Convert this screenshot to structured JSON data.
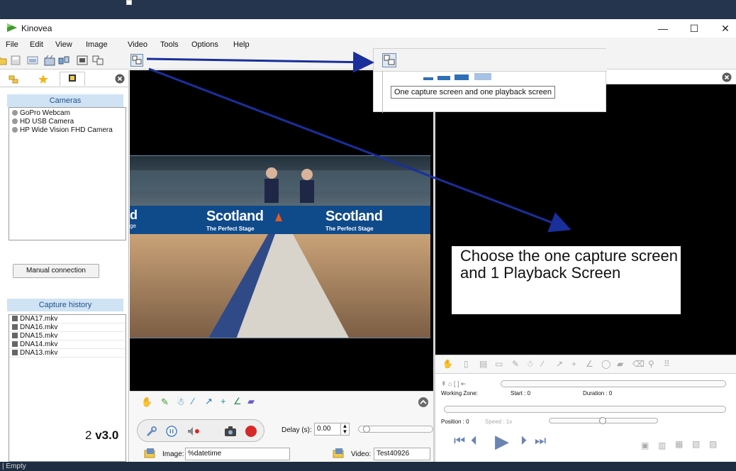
{
  "app": {
    "title": "Kinovea"
  },
  "window_controls": {
    "minimize": "—",
    "maximize": "☐",
    "close": "✕"
  },
  "menu": [
    "File",
    "Edit",
    "View",
    "Image",
    "Video",
    "Tools",
    "Options",
    "Help"
  ],
  "left_panel": {
    "cameras_title": "Cameras",
    "cameras": [
      "GoPro Webcam",
      "HD USB Camera",
      "HP Wide Vision FHD Camera"
    ],
    "manual_connection": "Manual connection",
    "history_title": "Capture history",
    "history": [
      "DNA17.mkv",
      "DNA16.mkv",
      "DNA15.mkv",
      "DNA14.mkv",
      "DNA13.mkv"
    ],
    "version_overlay": {
      "prefix": "2 ",
      "version": "v3.0"
    }
  },
  "capture": {
    "banner_left": "d",
    "banner_left_sub": "ge",
    "banner1_title": "Scotland",
    "banner1_sub": "The Perfect Stage",
    "banner2_title": "Scotland",
    "banner2_sub": "The Perfect Stage",
    "delay_label": "Delay (s):",
    "delay_value": "0.00",
    "image_label": "Image:",
    "image_value": "%datetime",
    "video_label": "Video:",
    "video_value": "Test40926"
  },
  "playback": {
    "working_zone": "Working Zone:",
    "start": "Start : 0",
    "duration": "Duration : 0",
    "position": "Position : 0",
    "speed": "Speed : 1x"
  },
  "tooltip": {
    "text": "One capture screen and one playback screen"
  },
  "callout": {
    "text": "Choose the one capture screen and 1 Playback Screen"
  },
  "status": {
    "text": "| Empty"
  },
  "colors": {
    "arrow": "#1a2f9c",
    "section_bg": "#cfe3f4",
    "record": "#d62828",
    "banner": "#1530c8"
  }
}
